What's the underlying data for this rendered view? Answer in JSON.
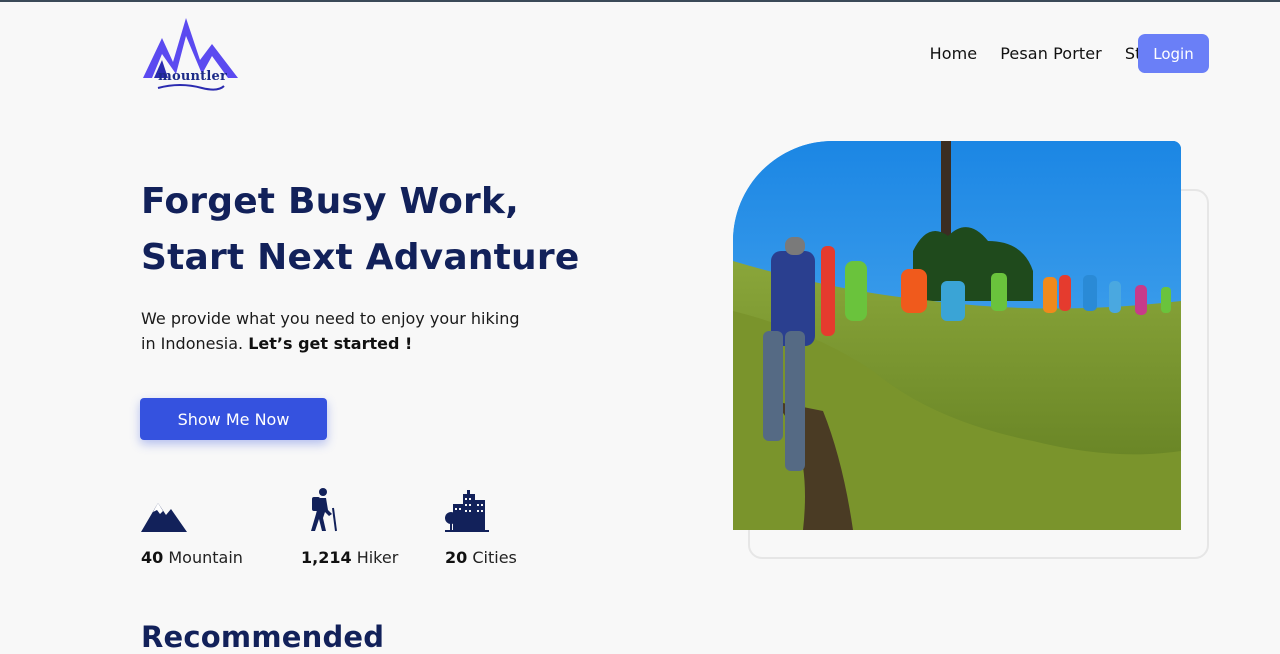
{
  "brand": {
    "name": "mountler",
    "color": "#5b4af0"
  },
  "nav": {
    "items": [
      "Home",
      "Pesan Porter",
      "Stories"
    ],
    "login_label": "Login"
  },
  "hero": {
    "title_line1": "Forget Busy Work,",
    "title_line2": "Start Next Advanture",
    "desc_plain": "We provide what you need to enjoy your hiking in Indonesia. ",
    "desc_bold": "Let’s get started !",
    "cta_label": "Show Me Now"
  },
  "stats": [
    {
      "icon": "mountain-icon",
      "value": "40",
      "label": "Mountain"
    },
    {
      "icon": "hiker-icon",
      "value": "1,214",
      "label": "Hiker"
    },
    {
      "icon": "city-icon",
      "value": "20",
      "label": "Cities"
    }
  ],
  "section": {
    "title": "Recommended"
  },
  "colors": {
    "primary": "#3552df",
    "login": "#6a7ff7",
    "heading": "#12215a"
  }
}
